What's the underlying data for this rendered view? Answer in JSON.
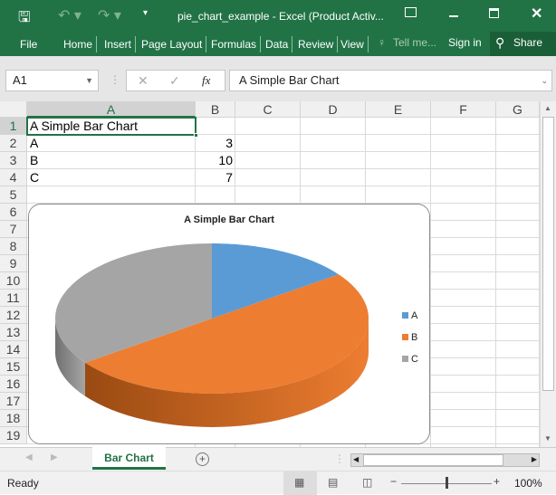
{
  "window": {
    "title": "pie_chart_example - Excel (Product Activ..."
  },
  "ribbon": {
    "tabs": [
      "File",
      "Home",
      "Insert",
      "Page Layout",
      "Formulas",
      "Data",
      "Review",
      "View"
    ],
    "tell_me": "Tell me...",
    "sign_in": "Sign in",
    "share": "Share"
  },
  "formula_bar": {
    "name_box": "A1",
    "fx": "fx",
    "value": "A Simple Bar Chart"
  },
  "columns": [
    "A",
    "B",
    "C",
    "D",
    "E",
    "F",
    "G"
  ],
  "rows": [
    "1",
    "2",
    "3",
    "4",
    "5",
    "6",
    "7",
    "8",
    "9",
    "10",
    "11",
    "12",
    "13",
    "14",
    "15",
    "16",
    "17",
    "18",
    "19"
  ],
  "cells": {
    "A1": "A Simple Bar Chart",
    "A2": "A",
    "B2": "3",
    "A3": "B",
    "B3": "10",
    "A4": "C",
    "B4": "7"
  },
  "chart_data": {
    "type": "pie",
    "title": "A Simple Bar Chart",
    "categories": [
      "A",
      "B",
      "C"
    ],
    "values": [
      3,
      10,
      7
    ],
    "colors": [
      "#5b9bd5",
      "#ed7d31",
      "#a5a5a5"
    ],
    "side_colors": [
      "#3a6fa0",
      "#9a4a12",
      "#707070"
    ],
    "legend": "right",
    "style": "3d"
  },
  "sheet_tabs": [
    {
      "label": "Bar Chart",
      "active": true
    }
  ],
  "status": {
    "text": "Ready",
    "zoom": "100%",
    "zoom_level": 100
  }
}
